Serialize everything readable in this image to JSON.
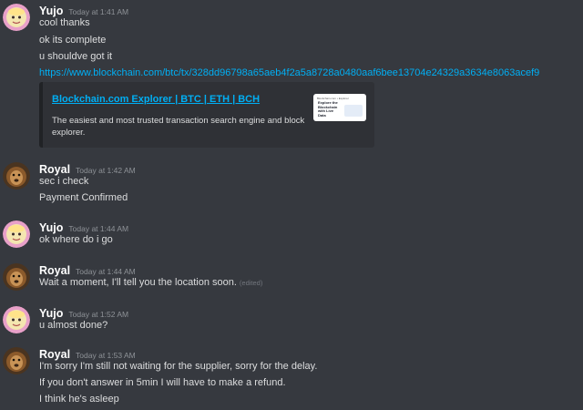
{
  "messages": [
    {
      "user": "Yujo",
      "time": "Today at 1:41 AM",
      "avatar": "yujo-avatar",
      "lines": [
        "cool thanks",
        "ok its complete",
        "u shouldve got it"
      ],
      "link": "https://www.blockchain.com/btc/tx/328dd96798a65aeb4f2a5a8728a0480aaf6bee13704e24329a3634e8063acef9",
      "embed": {
        "title": "Blockchain.com Explorer | BTC | ETH | BCH",
        "description": "The easiest and most trusted transaction search engine and block explorer.",
        "thumb_header": "Blockchain.com • Explorer",
        "thumb_text": "Explore the Blockchain with Live Data"
      }
    },
    {
      "user": "Royal",
      "time": "Today at 1:42 AM",
      "avatar": "lion-avatar",
      "lines": [
        "sec i check",
        "Payment Confirmed"
      ]
    },
    {
      "user": "Yujo",
      "time": "Today at 1:44 AM",
      "avatar": "yujo-avatar",
      "lines": [
        "ok where do i go"
      ]
    },
    {
      "user": "Royal",
      "time": "Today at 1:44 AM",
      "avatar": "lion-avatar",
      "lines": [
        "Wait a moment, I'll tell you the location soon."
      ],
      "edited": "(edited)"
    },
    {
      "user": "Yujo",
      "time": "Today at 1:52 AM",
      "avatar": "yujo-avatar",
      "lines": [
        "u almost done?"
      ]
    },
    {
      "user": "Royal",
      "time": "Today at 1:53 AM",
      "avatar": "lion-avatar",
      "lines": [
        "I'm sorry I'm still not waiting for the supplier, sorry for the delay.",
        "If you don't answer in 5min I will have to make a refund.",
        "I think he's asleep"
      ]
    }
  ],
  "colors": {
    "background": "#36393f",
    "link": "#00aff4",
    "username": "#ffffff",
    "timestamp": "#8e9297",
    "embed_bg": "#2f3136"
  }
}
